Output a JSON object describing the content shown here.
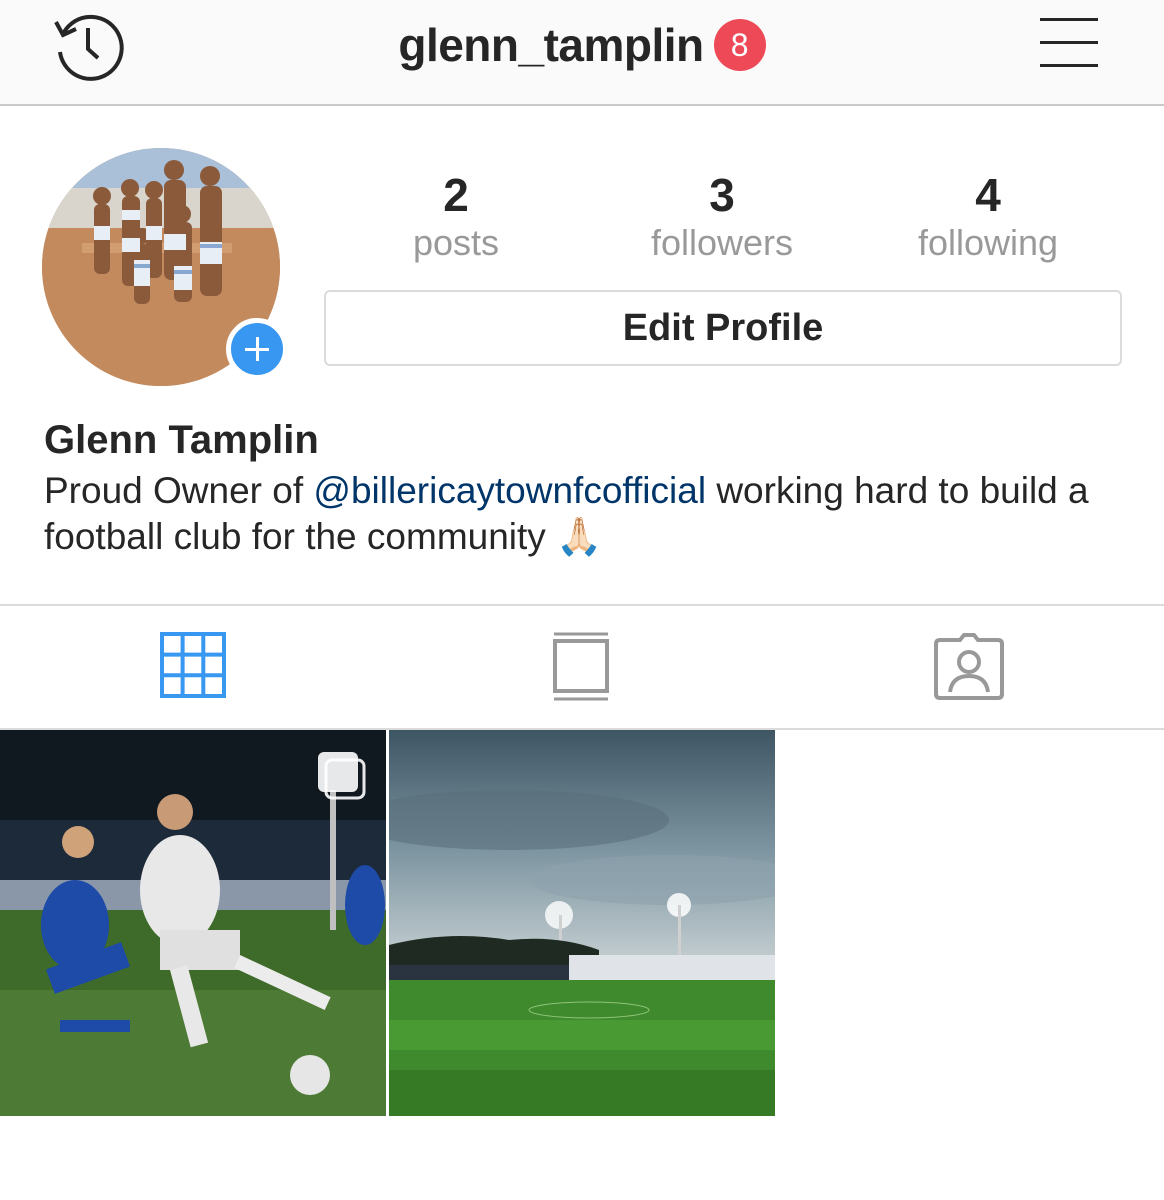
{
  "header": {
    "username": "glenn_tamplin",
    "notification_count": "8",
    "icons": {
      "history": "history-icon",
      "menu": "hamburger-menu-icon"
    }
  },
  "profile": {
    "stats": {
      "posts_count": "2",
      "posts_label": "posts",
      "followers_count": "3",
      "followers_label": "followers",
      "following_count": "4",
      "following_label": "following"
    },
    "edit_profile_label": "Edit Profile",
    "full_name": "Glenn Tamplin",
    "bio": {
      "text_before": "Proud Owner of ",
      "mention": "@billericaytownfcofficial",
      "text_after": " working hard to build a football club for the community ",
      "emoji": "🙏🏻"
    }
  },
  "tabs": [
    {
      "name": "grid",
      "active": true
    },
    {
      "name": "feed",
      "active": false
    },
    {
      "name": "tagged",
      "active": false
    }
  ],
  "colors": {
    "accent": "#3897f0",
    "badge": "#ed4956",
    "mention": "#003569",
    "muted": "#999999",
    "text": "#262626"
  }
}
